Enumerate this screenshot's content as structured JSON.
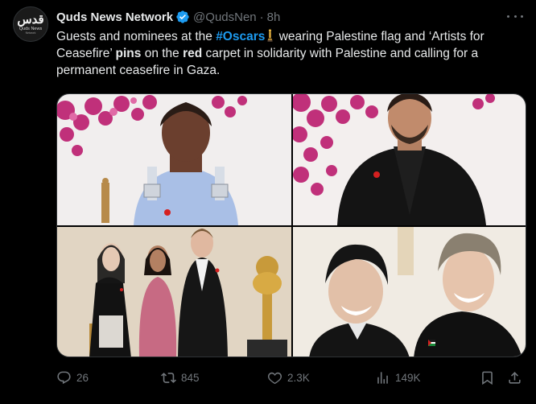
{
  "account": {
    "display_name": "Quds News Network",
    "handle": "@QudsNen",
    "separator": "·",
    "time": "8h",
    "avatar_text_arabic": "قدس",
    "avatar_text_en": "Quds News",
    "avatar_text_sub": "Network"
  },
  "tweet": {
    "text_1": "Guests and nominees at the ",
    "hashtag": "#Oscars",
    "text_2": " wearing Palestine flag and ‘Artists for Ceasefire’ ",
    "bold_1": "pins",
    "text_3": " on the ",
    "bold_2": "red",
    "text_4": " carpet in solidarity with Palestine and calling for a permanent ceasefire in Gaza."
  },
  "media": [
    {
      "name": "photo-woman-blue-dress"
    },
    {
      "name": "photo-man-black-suit"
    },
    {
      "name": "photo-group-oscar-statue"
    },
    {
      "name": "photo-two-men-smiling"
    }
  ],
  "actions": {
    "replies": "26",
    "reposts": "845",
    "likes": "2.3K",
    "views": "149K"
  },
  "colors": {
    "background": "#000000",
    "text": "#e7e9ea",
    "muted": "#71767b",
    "link": "#1d9bf0",
    "verified": "#1d9bf0"
  }
}
